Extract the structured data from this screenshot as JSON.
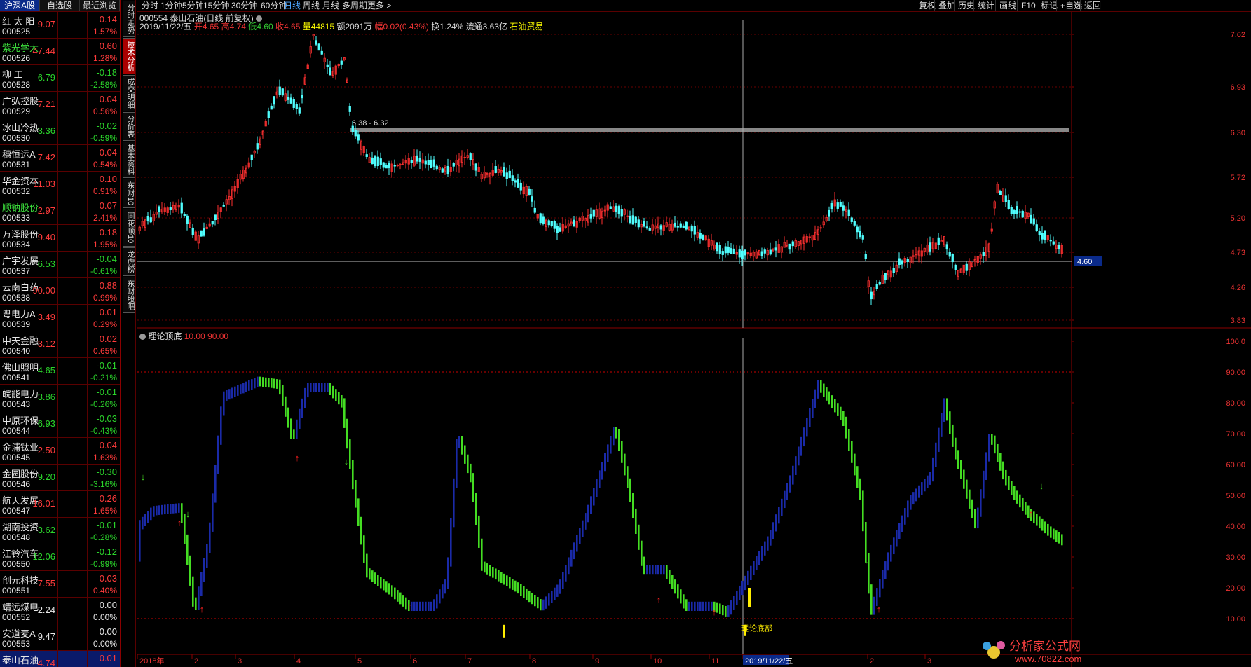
{
  "left_tabs": [
    "沪深A股",
    "自选股",
    "最近浏览"
  ],
  "stocks": [
    {
      "name": "红 太 阳",
      "code": "000525",
      "price": "9.07",
      "chg": "0.14",
      "pct": "1.57%",
      "dir": "up",
      "name_color": "#e8e8e8"
    },
    {
      "name": "紫光学大",
      "code": "000526",
      "price": "47.44",
      "chg": "0.60",
      "pct": "1.28%",
      "dir": "up",
      "name_color": "#3ce03c"
    },
    {
      "name": "柳  工",
      "code": "000528",
      "price": "6.79",
      "chg": "-0.18",
      "pct": "-2.58%",
      "dir": "down",
      "name_color": "#e8e8e8"
    },
    {
      "name": "广弘控股",
      "code": "000529",
      "price": "7.21",
      "chg": "0.04",
      "pct": "0.56%",
      "dir": "up",
      "name_color": "#e8e8e8"
    },
    {
      "name": "冰山冷热",
      "code": "000530",
      "price": "3.36",
      "chg": "-0.02",
      "pct": "-0.59%",
      "dir": "down",
      "name_color": "#e8e8e8"
    },
    {
      "name": "穗恒运A",
      "code": "000531",
      "price": "7.42",
      "chg": "0.04",
      "pct": "0.54%",
      "dir": "up",
      "name_color": "#e8e8e8"
    },
    {
      "name": "华金资本",
      "code": "000532",
      "price": "11.03",
      "chg": "0.10",
      "pct": "0.91%",
      "dir": "up",
      "name_color": "#e8e8e8"
    },
    {
      "name": "顺钠股份",
      "code": "000533",
      "price": "2.97",
      "chg": "0.07",
      "pct": "2.41%",
      "dir": "up",
      "name_color": "#3ce03c"
    },
    {
      "name": "万泽股份",
      "code": "000534",
      "price": "9.40",
      "chg": "0.18",
      "pct": "1.95%",
      "dir": "up",
      "name_color": "#e8e8e8"
    },
    {
      "name": "广宇发展",
      "code": "000537",
      "price": "6.53",
      "chg": "-0.04",
      "pct": "-0.61%",
      "dir": "down",
      "name_color": "#e8e8e8"
    },
    {
      "name": "云南白药",
      "code": "000538",
      "price": "90.00",
      "chg": "0.88",
      "pct": "0.99%",
      "dir": "up",
      "name_color": "#e8e8e8"
    },
    {
      "name": "粤电力A",
      "code": "000539",
      "price": "3.49",
      "chg": "0.01",
      "pct": "0.29%",
      "dir": "up",
      "name_color": "#e8e8e8"
    },
    {
      "name": "中天金融",
      "code": "000540",
      "price": "3.12",
      "chg": "0.02",
      "pct": "0.65%",
      "dir": "up",
      "name_color": "#e8e8e8"
    },
    {
      "name": "佛山照明",
      "code": "000541",
      "price": "4.65",
      "chg": "-0.01",
      "pct": "-0.21%",
      "dir": "down",
      "name_color": "#e8e8e8"
    },
    {
      "name": "皖能电力",
      "code": "000543",
      "price": "3.86",
      "chg": "-0.01",
      "pct": "-0.26%",
      "dir": "down",
      "name_color": "#e8e8e8"
    },
    {
      "name": "中原环保",
      "code": "000544",
      "price": "6.93",
      "chg": "-0.03",
      "pct": "-0.43%",
      "dir": "down",
      "name_color": "#e8e8e8"
    },
    {
      "name": "金浦钛业",
      "code": "000545",
      "price": "2.50",
      "chg": "0.04",
      "pct": "1.63%",
      "dir": "up",
      "name_color": "#e8e8e8"
    },
    {
      "name": "金圆股份",
      "code": "000546",
      "price": "9.20",
      "chg": "-0.30",
      "pct": "-3.16%",
      "dir": "down",
      "name_color": "#e8e8e8"
    },
    {
      "name": "航天发展",
      "code": "000547",
      "price": "16.01",
      "chg": "0.26",
      "pct": "1.65%",
      "dir": "up",
      "name_color": "#e8e8e8"
    },
    {
      "name": "湖南投资",
      "code": "000548",
      "price": "3.62",
      "chg": "-0.01",
      "pct": "-0.28%",
      "dir": "down",
      "name_color": "#e8e8e8"
    },
    {
      "name": "江铃汽车",
      "code": "000550",
      "price": "12.06",
      "chg": "-0.12",
      "pct": "-0.99%",
      "dir": "down",
      "name_color": "#e8e8e8"
    },
    {
      "name": "创元科技",
      "code": "000551",
      "price": "7.55",
      "chg": "0.03",
      "pct": "0.40%",
      "dir": "up",
      "name_color": "#e8e8e8"
    },
    {
      "name": "靖远煤电",
      "code": "000552",
      "price": "2.24",
      "chg": "0.00",
      "pct": "0.00%",
      "dir": "flat",
      "name_color": "#e8e8e8"
    },
    {
      "name": "安道麦A",
      "code": "000553",
      "price": "9.47",
      "chg": "0.00",
      "pct": "0.00%",
      "dir": "flat",
      "name_color": "#e8e8e8"
    },
    {
      "name": "泰山石油",
      "code": "000554",
      "price": "4.74",
      "chg": "0.01",
      "pct": "",
      "dir": "up",
      "name_color": "#e8e8e8",
      "selected": true
    }
  ],
  "vtabs": [
    {
      "label": "分时走势",
      "active": false
    },
    {
      "label": "技术分析",
      "active": true
    },
    {
      "label": "成交明细",
      "active": false
    },
    {
      "label": "分价表",
      "active": false
    },
    {
      "label": "基本资料",
      "active": false
    },
    {
      "label": "东财10",
      "active": false
    },
    {
      "label": "同花顺10",
      "active": false
    },
    {
      "label": "龙虎榜",
      "active": false
    },
    {
      "label": "东财股吧",
      "active": false
    }
  ],
  "toolbar": {
    "periods": [
      "分时",
      "1分钟",
      "5分钟",
      "15分钟",
      "30分钟",
      "60分钟",
      "日线",
      "周线",
      "月线",
      "多周期",
      "更多 >"
    ],
    "active": "日线",
    "right": [
      "复权",
      "叠加",
      "历史",
      "统计",
      "画线",
      "F10",
      "标记",
      "+自选",
      "返回"
    ]
  },
  "main_info": {
    "title": "000554 泰山石油(日线 前复权)",
    "date": "2019/11/22/五",
    "open_label": "开",
    "open": "4.65",
    "high_label": "高",
    "high": "4.74",
    "low_label": "低",
    "low": "4.60",
    "close_label": "收",
    "close": "4.65",
    "vol_label": "量",
    "vol": "44815",
    "amt_label": "额",
    "amt": "2091万",
    "rng_label": "幅",
    "rng": "0.02(0.43%)",
    "turn_label": "换",
    "turn": "1.24%",
    "float_label": "流通",
    "float": "3.63亿",
    "sector": "石油贸易"
  },
  "price_axis": [
    "7.62",
    "6.93",
    "6.30",
    "5.72",
    "5.20",
    "4.73",
    "4.26",
    "3.83"
  ],
  "price_current": "4.60",
  "range_label": "6.38 - 6.32",
  "indicator": {
    "name": "理论顶底",
    "p1": "10.00",
    "p2": "90.00",
    "axis": [
      "100.0",
      "90.00",
      "80.00",
      "70.00",
      "60.00",
      "50.00",
      "40.00",
      "30.00",
      "20.00",
      "10.00"
    ],
    "bottom_text": "理论底部"
  },
  "x_axis": [
    "2018年",
    "2",
    "3",
    "4",
    "5",
    "6",
    "7",
    "8",
    "9",
    "10",
    "11",
    "2019/11/22/五",
    "2",
    "3"
  ],
  "logo": {
    "text": "分析家公式网",
    "url": "www.70822.com"
  }
}
